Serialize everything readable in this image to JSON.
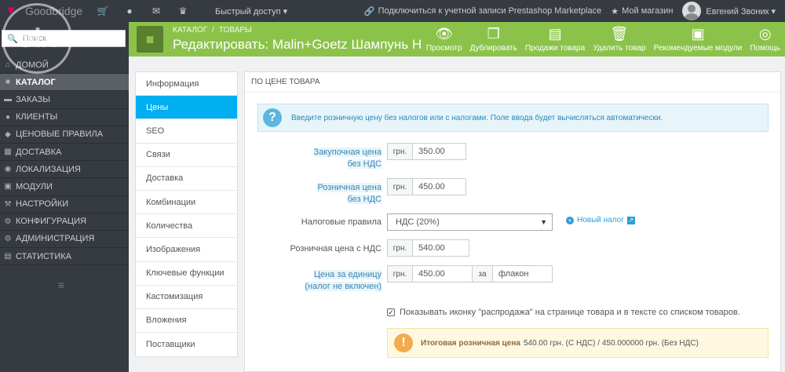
{
  "topbar": {
    "brand": "Goodbridge",
    "quick_access": "Быстрый доступ ▾",
    "marketplace": "Подключиться к учетной записи Prestashop Marketplace",
    "my_shop": "Мой магазин",
    "user": "Евгений Звоник ▾"
  },
  "sidebar": {
    "search_placeholder": "Поиск",
    "items": [
      {
        "label": "Домой",
        "icon": "home-icon"
      },
      {
        "label": "Каталог",
        "icon": "book-icon"
      },
      {
        "label": "Заказы",
        "icon": "credit-card-icon"
      },
      {
        "label": "Клиенты",
        "icon": "users-icon"
      },
      {
        "label": "Ценовые правила",
        "icon": "tag-icon"
      },
      {
        "label": "Доставка",
        "icon": "truck-icon"
      },
      {
        "label": "Локализация",
        "icon": "globe-icon"
      },
      {
        "label": "Модули",
        "icon": "puzzle-icon"
      },
      {
        "label": "Настройки",
        "icon": "wrench-icon"
      },
      {
        "label": "Конфигурация",
        "icon": "cogs-icon"
      },
      {
        "label": "Администрация",
        "icon": "cog-icon"
      },
      {
        "label": "Статистика",
        "icon": "bar-chart-icon"
      }
    ]
  },
  "header": {
    "breadcrumb": [
      "Каталог",
      "/",
      "Товары"
    ],
    "title": "Редактировать: Malin+Goetz Шампунь Н",
    "actions": [
      {
        "label": "Просмотр",
        "icon": "eye-icon"
      },
      {
        "label": "Дублировать",
        "icon": "copy-icon"
      },
      {
        "label": "Продажи товара",
        "icon": "bar-chart-icon"
      },
      {
        "label": "Удалить товар",
        "icon": "trash-icon"
      },
      {
        "label": "Рекомендуемые модули",
        "icon": "puzzle-icon"
      },
      {
        "label": "Помощь",
        "icon": "lifebuoy-icon"
      }
    ]
  },
  "tabs": [
    "Информация",
    "Цены",
    "SEO",
    "Связи",
    "Доставка",
    "Комбинации",
    "Количества",
    "Изображения",
    "Ключевые функции",
    "Кастомизация",
    "Вложения",
    "Поставщики"
  ],
  "panel": {
    "heading": "По цене товара",
    "info": "Введите розничную цену без налогов или с налогами. Поле ввода будет вычисляться автоматически.",
    "wholesale_label_1": "Закупочная цена",
    "wholesale_label_2": "без НДС",
    "retail_label_1": "Розничная цена",
    "retail_label_2": "без НДС",
    "tax_rules_label": "Налоговые правила",
    "retail_tax_label": "Розничная цена с НДС",
    "unit_label_1": "Цена за единицу",
    "unit_label_2": "(налог не включен)",
    "currency": "грн.",
    "wholesale_value": "350.00",
    "retail_value": "450.00",
    "tax_rule": "НДС (20%)",
    "new_tax": "Новый налог",
    "retail_tax_value": "540.00",
    "unit_value": "450.00",
    "unit_per": "за",
    "unit_name": "флакон",
    "sale_checkbox": "Показывать иконку \"распродажа\" на странице товара и в тексте со списком товаров.",
    "final_label": "Итоговая розничная цена",
    "final_value": "540.00 грн. (С НДС) / 450.000000 грн. (Без НДС)"
  }
}
